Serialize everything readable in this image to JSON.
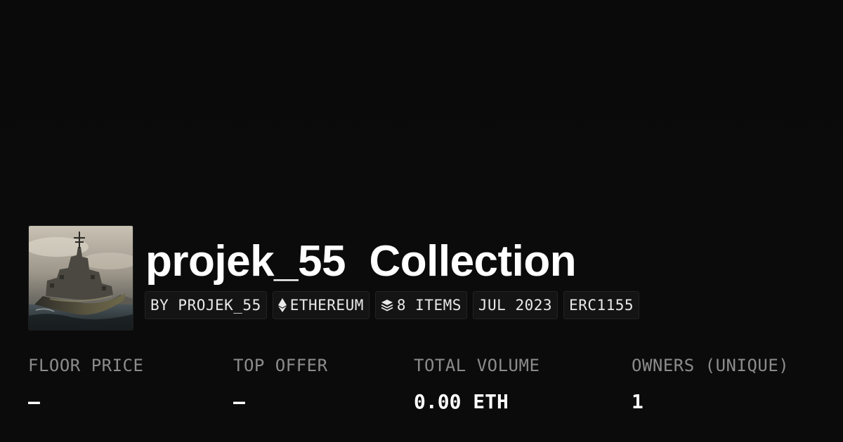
{
  "collection": {
    "name": "projek_55",
    "suffix": "Collection",
    "avatar_icon": "warship-artwork"
  },
  "chips": [
    {
      "icon": "",
      "label": "BY PROJEK_55"
    },
    {
      "icon": "ethereum-icon",
      "label": "ETHEREUM"
    },
    {
      "icon": "layers-icon",
      "label": "8 ITEMS"
    },
    {
      "icon": "",
      "label": "JUL 2023"
    },
    {
      "icon": "",
      "label": "ERC1155"
    }
  ],
  "stats": [
    {
      "label": "FLOOR PRICE",
      "value": "–"
    },
    {
      "label": "TOP OFFER",
      "value": "–"
    },
    {
      "label": "TOTAL VOLUME",
      "value": "0.00 ETH"
    },
    {
      "label": "OWNERS (UNIQUE)",
      "value": "1"
    }
  ],
  "colors": {
    "background": "#0b0b0b",
    "chip_background": "#141414",
    "label_gray": "#8c8c8c",
    "text": "#ffffff"
  }
}
